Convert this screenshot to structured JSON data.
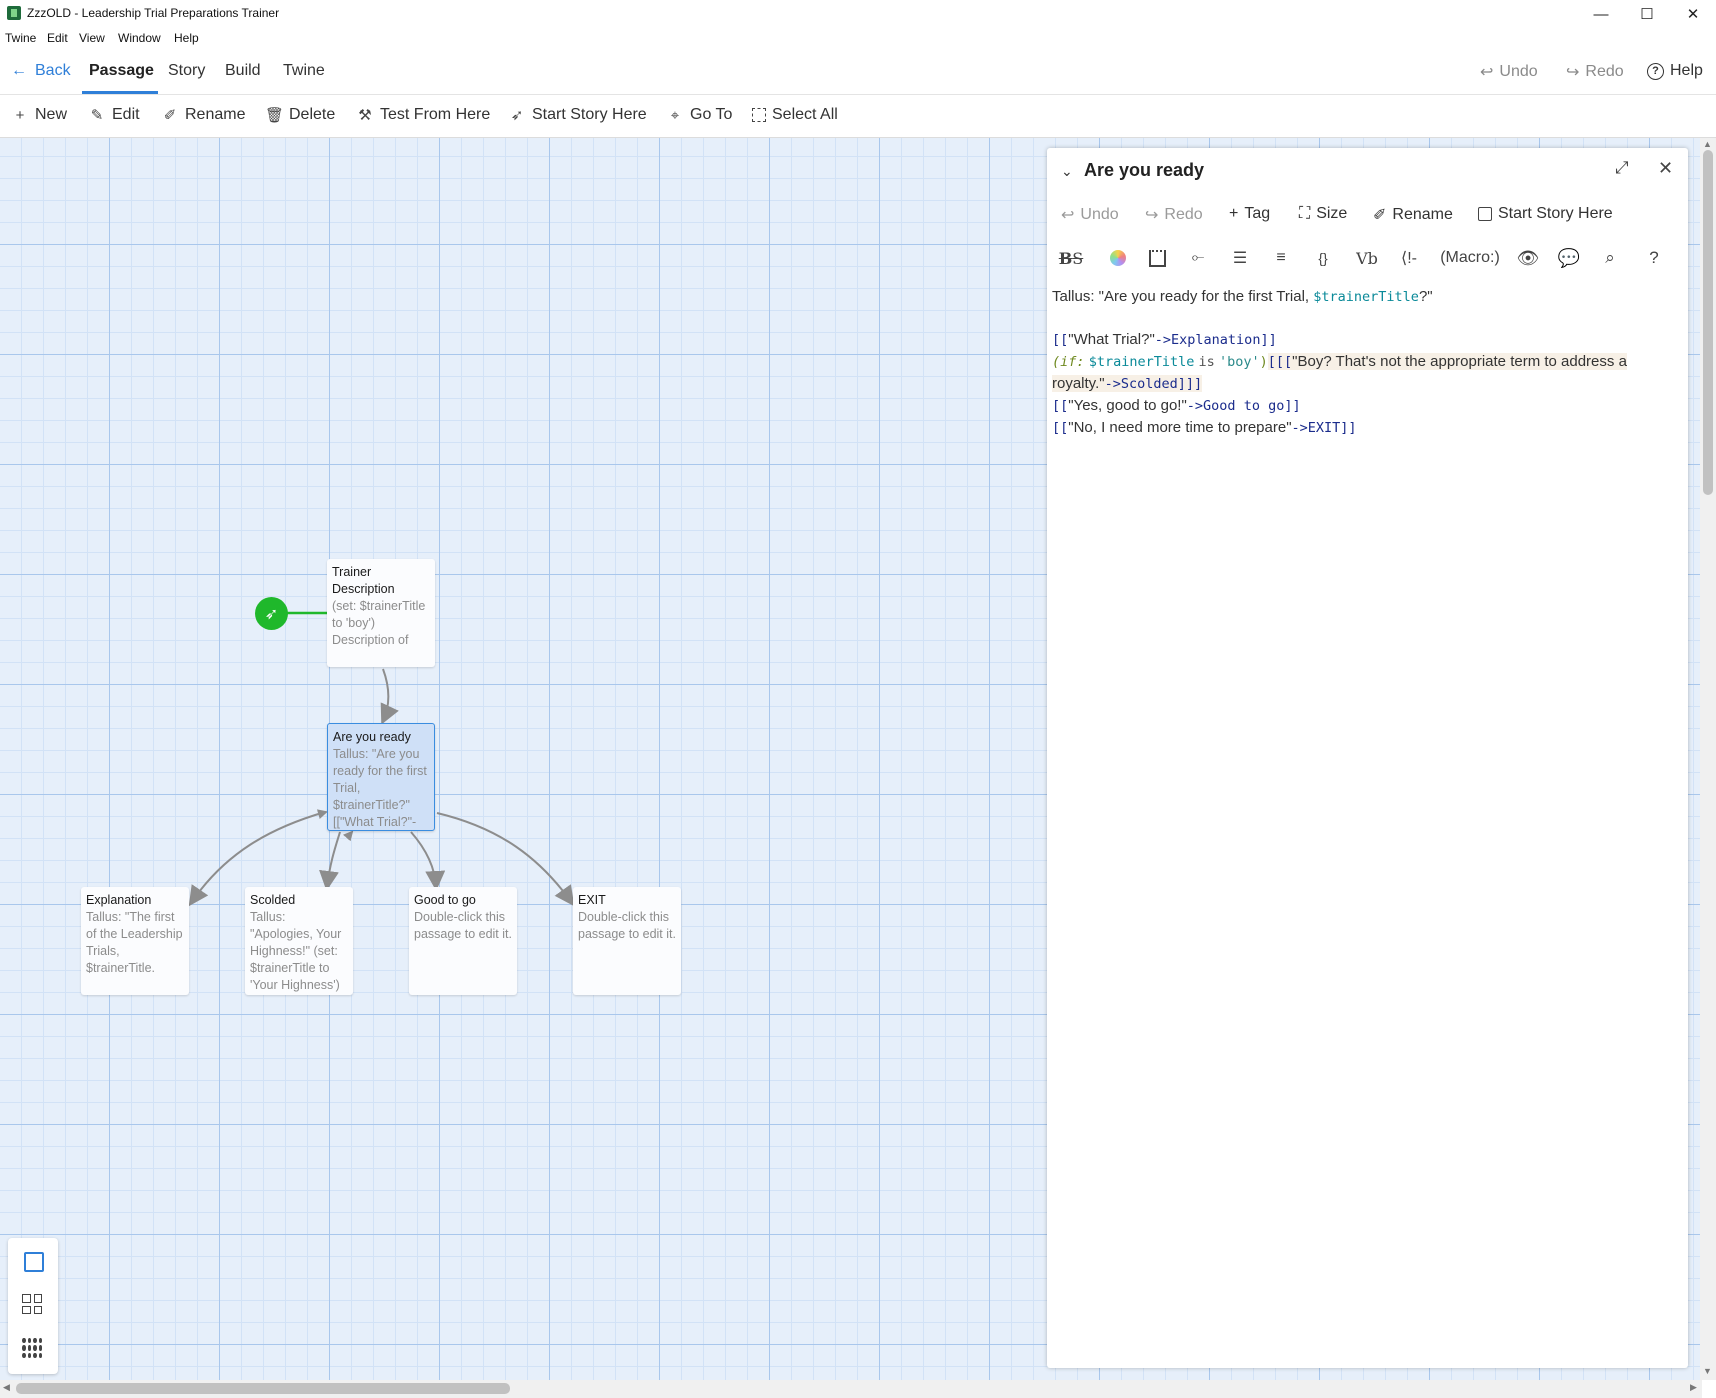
{
  "window": {
    "title": "ZzzOLD - Leadership Trial Preparations Trainer",
    "minimize": "—",
    "maximize": "☐",
    "close": "✕"
  },
  "menu": [
    "Twine",
    "Edit",
    "View",
    "Window",
    "Help"
  ],
  "topnav": {
    "back": "Back",
    "tabs": [
      "Passage",
      "Story",
      "Build",
      "Twine"
    ],
    "undo": "Undo",
    "redo": "Redo",
    "help": "Help"
  },
  "toolbar": {
    "new": "New",
    "edit": "Edit",
    "rename": "Rename",
    "delete": "Delete",
    "test_from_here": "Test From Here",
    "start_story_here": "Start Story Here",
    "go_to": "Go To",
    "select_all": "Select All"
  },
  "passages": [
    {
      "title": "Trainer Description",
      "excerpt": "(set: $trainerTitle to 'boy') Description of"
    },
    {
      "title": "Are you ready",
      "excerpt": "Tallus: \"Are you ready for the first Trial, $trainerTitle?\" [[\"What Trial?\"-"
    },
    {
      "title": "Explanation",
      "excerpt": "Tallus: \"The first of the Leadership Trials, $trainerTitle."
    },
    {
      "title": "Scolded",
      "excerpt": "Tallus: \"Apologies, Your Highness!\" (set: $trainerTitle to 'Your Highness')"
    },
    {
      "title": "Good to go",
      "excerpt": "Double-click this passage to edit it."
    },
    {
      "title": "EXIT",
      "excerpt": "Double-click this passage to edit it."
    }
  ],
  "panel": {
    "title": "Are you ready",
    "undo": "Undo",
    "redo": "Redo",
    "tag": "Tag",
    "size": "Size",
    "rename": "Rename",
    "start_story_here": "Start Story Here",
    "macro_button": "(Macro:)",
    "format_icons": [
      "strikethrough-icon",
      "color-icon",
      "border-icon",
      "align-icon",
      "list-icon",
      "center-icon",
      "braces-icon",
      "verbatim-icon",
      "comment-icon"
    ],
    "editor": {
      "l1_prefix": "Tallus: \"Are you ready for the first Trial, ",
      "l1_var": "$trainerTitle",
      "l1_suffix": "?\"",
      "l2_open": "[[",
      "l2_text": "\"What Trial?\"",
      "l2_link": "->Explanation]]",
      "l3_macro": "(if:",
      "l3_var": "$trainerTitle",
      "l3_is": "is",
      "l3_str": "'boy'",
      "l3_close": ")",
      "l3_hook": "[[[",
      "l3_text": "\"Boy? That's not the appropriate term to address a royalty.\"",
      "l3_link": "->Scolded]]]",
      "l4_open": "[[",
      "l4_text": "\"Yes, good to go!\"",
      "l4_link": "->Good to go]]",
      "l5_open": "[[",
      "l5_text": "\"No, I need more time to prepare\"",
      "l5_link": "->EXIT]]"
    }
  },
  "zoom": [
    "passage-zoom-icon",
    "grid-zoom-icon",
    "dots-zoom-icon"
  ]
}
